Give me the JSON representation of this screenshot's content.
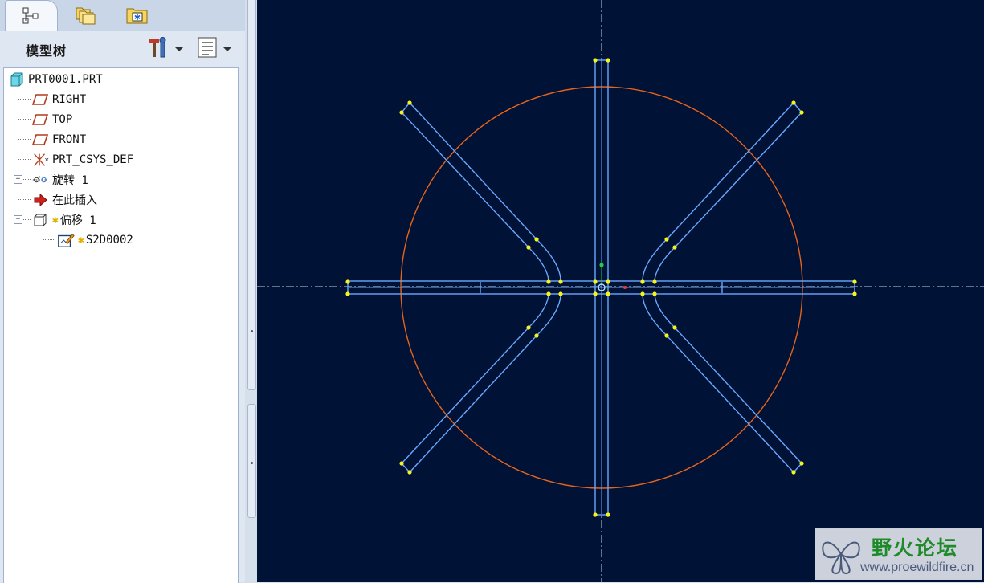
{
  "tabs": [
    {
      "icon": "model-tree-icon"
    },
    {
      "icon": "folder-browser-icon"
    },
    {
      "icon": "favorites-icon"
    }
  ],
  "panel": {
    "title": "模型树",
    "tools_icon": "hammer-wrench-icon",
    "show_icon": "list-settings-icon"
  },
  "tree": {
    "root": {
      "label": "PRT0001.PRT",
      "icon": "part-icon"
    },
    "items": [
      {
        "label": "RIGHT",
        "icon": "datum-plane-icon"
      },
      {
        "label": "TOP",
        "icon": "datum-plane-icon"
      },
      {
        "label": "FRONT",
        "icon": "datum-plane-icon"
      },
      {
        "label": "PRT_CSYS_DEF",
        "icon": "coordinate-system-icon"
      },
      {
        "label": "旋转 1",
        "icon": "revolve-icon",
        "expanded": false
      },
      {
        "label": "在此插入",
        "icon": "insert-here-arrow-icon"
      },
      {
        "label": "偏移 1",
        "icon": "offset-feature-icon",
        "expanded": true,
        "new": true
      },
      {
        "label": "S2D0002",
        "icon": "sketch-icon",
        "new": true
      }
    ]
  },
  "viewport": {
    "background": "#001236",
    "circle_color": "#e8631a",
    "profile_color": "#6aa8ff",
    "vertex_color": "#f5f51a",
    "centerline_color": "#c8d0e0"
  },
  "watermark": {
    "text": "野火论坛",
    "url": "www.proewildfire.cn"
  }
}
